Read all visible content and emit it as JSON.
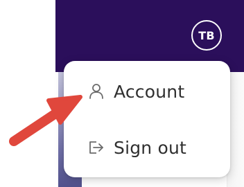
{
  "user": {
    "initials": "TB"
  },
  "menu": {
    "items": [
      {
        "label": "Account",
        "icon": "person-icon"
      },
      {
        "label": "Sign out",
        "icon": "sign-out-icon"
      }
    ]
  },
  "colors": {
    "header": "#2b0f5b",
    "arrow": "#e0473c",
    "menu_text": "#2f2f2f",
    "icon": "#6b6b6b"
  }
}
